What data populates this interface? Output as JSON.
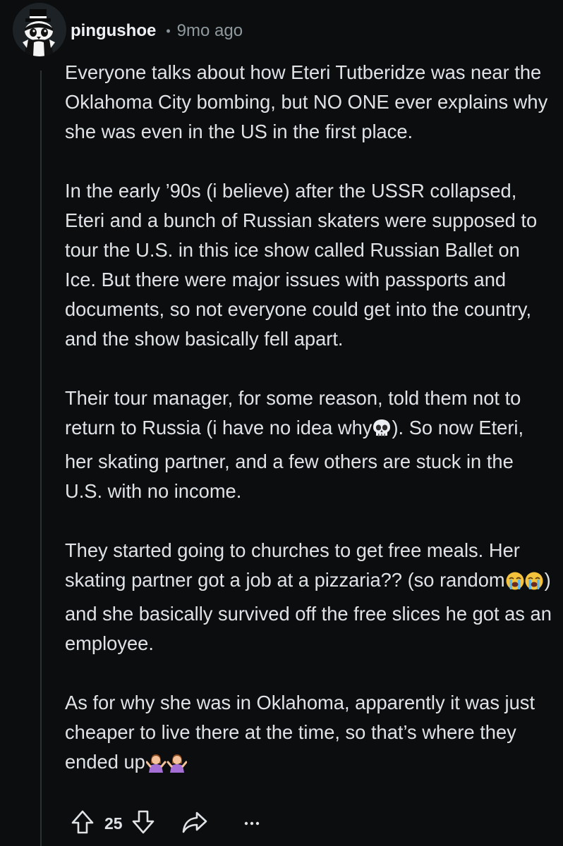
{
  "comment": {
    "author": "pingushoe",
    "separator": "•",
    "time_ago": "9mo ago",
    "paragraphs": [
      {
        "text": "Everyone talks about how Eteri Tutberidze was near the Oklahoma City bombing, but NO ONE ever explains why she was even in the US in the first place."
      },
      {
        "text": "In the early ’90s (i believe) after the USSR collapsed, Eteri and a bunch of Russian skaters were supposed to tour the U.S. in this ice show called Russian Ballet on Ice. But there were major issues with passports and documents, so not everyone could get into the country, and the show basically fell apart."
      },
      {
        "text_before": "Their tour manager, for some reason, told them not to return to Russia (i have no idea why",
        "emoji": "skull",
        "text_after": "). So now Eteri, her skating partner, and a few others are stuck in the U.S. with no income."
      },
      {
        "text_before": "They started going to churches to get free meals. Her skating partner got a job at a pizzaria?? (so random",
        "emoji": "loudly-crying-face x2",
        "text_after": ") and she basically survived off the free slices he got as an employee."
      },
      {
        "text_before": "As for why she was in Oklahoma, apparently it was just cheaper to live there at the time, so that’s where they ended up",
        "emoji": "person-shrugging x2",
        "text_after": ""
      }
    ]
  },
  "actions": {
    "upvote_icon": "arrow-up-icon",
    "vote_count": "25",
    "downvote_icon": "arrow-down-icon",
    "share_icon": "share-arrow-icon",
    "more_label": "···"
  },
  "colors": {
    "background": "#0b0d0e",
    "text": "#dfe3e6",
    "muted": "#8f999e",
    "thread_line": "#2b3236"
  }
}
